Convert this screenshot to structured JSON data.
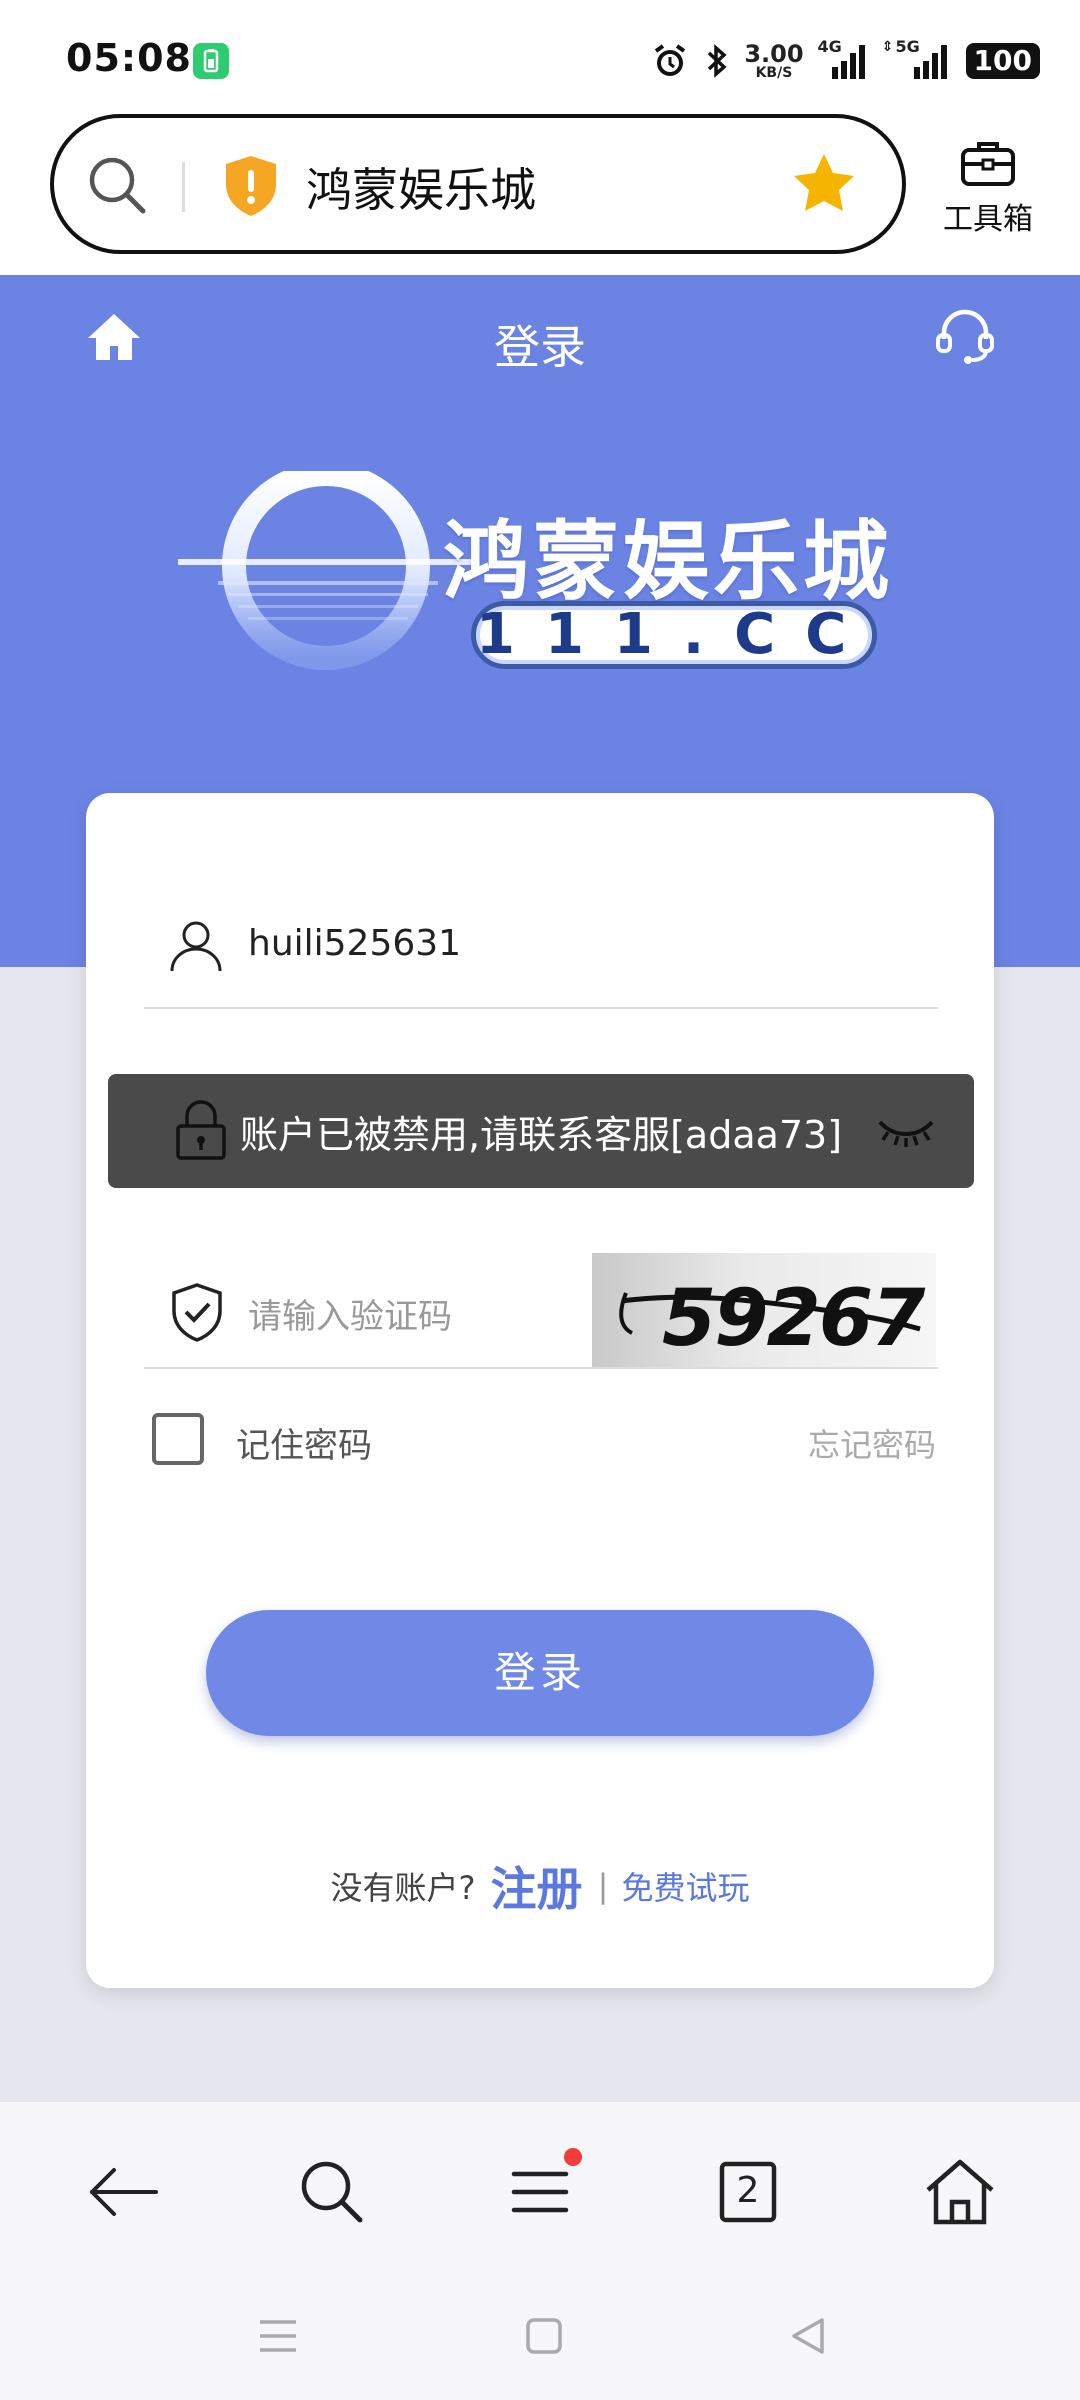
{
  "status_bar": {
    "time": "05:08",
    "net_speed_value": "3.00",
    "net_speed_unit": "KB/S",
    "signal_1": "4G",
    "signal_2": "5G",
    "battery": "100"
  },
  "browser": {
    "url_title": "鸿蒙娱乐城",
    "toolbox_label": "工具箱",
    "shield_color": "#f5a623",
    "star_color": "#f5b400"
  },
  "header": {
    "title": "登录",
    "brand_color": "#6b84e4"
  },
  "logo": {
    "name": "鸿蒙娱乐城",
    "domain": "111.CC"
  },
  "form": {
    "username_value": "huili525631",
    "toast_message": "账户已被禁用,请联系客服[adaa73]",
    "captcha_placeholder": "请输入验证码",
    "captcha_text": "59267",
    "remember_label": "记住密码",
    "forgot_label": "忘记密码",
    "login_label": "登录"
  },
  "footer": {
    "no_account": "没有账户?",
    "register": "注册",
    "separator": "|",
    "trial": "免费试玩"
  },
  "bottom_nav": {
    "tab_count": "2",
    "items": [
      "back-icon",
      "search-icon",
      "menu-icon",
      "tabs-icon",
      "home-icon"
    ]
  }
}
